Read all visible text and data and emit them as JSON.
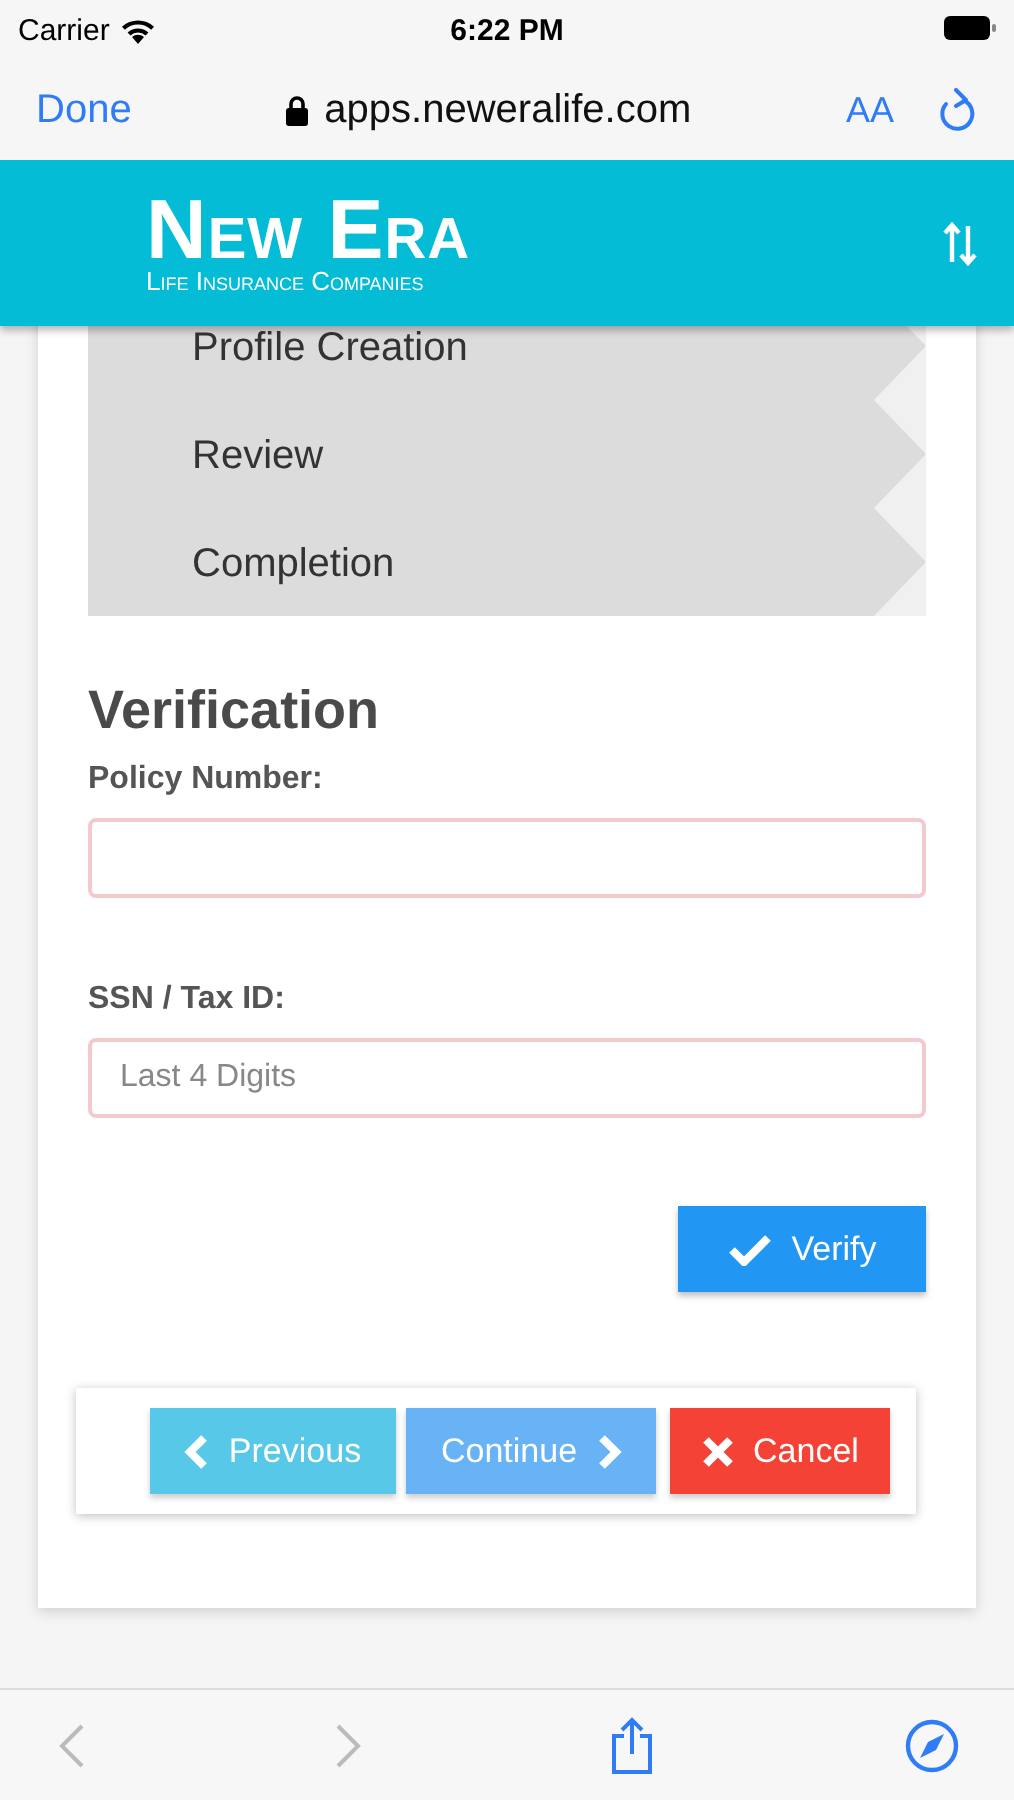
{
  "status_bar": {
    "carrier": "Carrier",
    "time": "6:22 PM"
  },
  "browser": {
    "done": "Done",
    "url": "apps.neweralife.com",
    "text_size": "AA"
  },
  "header": {
    "logo_title": "New Era",
    "logo_subtitle": "Life Insurance Companies"
  },
  "steps": [
    {
      "label": "Profile Creation"
    },
    {
      "label": "Review"
    },
    {
      "label": "Completion"
    }
  ],
  "form": {
    "title": "Verification",
    "fields": [
      {
        "label": "Policy Number:"
      },
      {
        "label": "SSN / Tax ID:",
        "placeholder": "Last 4 Digits"
      }
    ],
    "verify": "Verify"
  },
  "nav_buttons": [
    {
      "kind": "previous",
      "label": "Previous"
    },
    {
      "kind": "continue",
      "label": "Continue"
    },
    {
      "kind": "cancel",
      "label": "Cancel"
    }
  ]
}
